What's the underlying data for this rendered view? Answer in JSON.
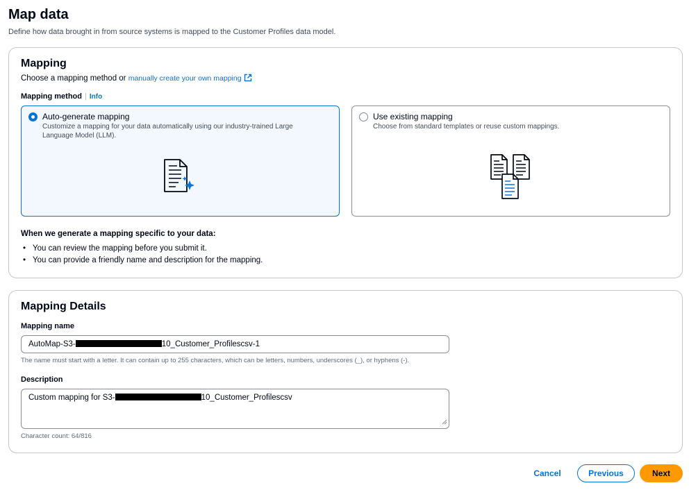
{
  "page": {
    "title": "Map data",
    "description": "Define how data brought in from source systems is mapped to the Customer Profiles data model."
  },
  "mapping": {
    "heading": "Mapping",
    "choose_text": "Choose a mapping method or",
    "manual_link": "manually create your own mapping",
    "method_label": "Mapping method",
    "info_link": "Info",
    "options": [
      {
        "title": "Auto-generate mapping",
        "description": "Customize a mapping for your data automatically using our industry-trained Large Language Model (LLM).",
        "selected": true,
        "icon": "document-sparkle-icon"
      },
      {
        "title": "Use existing mapping",
        "description": "Choose from standard templates or reuse custom mappings.",
        "selected": false,
        "icon": "documents-stack-icon"
      }
    ],
    "when_title": "When we generate a mapping specific to your data:",
    "bullets": [
      "You can review the mapping before you submit it.",
      "You can provide a friendly name and description for the mapping."
    ]
  },
  "details": {
    "heading": "Mapping Details",
    "name_label": "Mapping name",
    "name_prefix": "AutoMap-S3-",
    "name_suffix": "10_Customer_Profilescsv-1",
    "name_hint": "The name must start with a letter. It can contain up to 255 characters, which can be letters, numbers, underscores (_), or hyphens (-).",
    "desc_label": "Description",
    "desc_prefix": "Custom mapping for S3-",
    "desc_suffix": "10_Customer_Profilescsv",
    "char_count": "Character count: 64/816"
  },
  "actions": {
    "cancel": "Cancel",
    "previous": "Previous",
    "next": "Next"
  },
  "colors": {
    "accent": "#0972d3",
    "primary_button": "#ff9900",
    "selected_tile_bg": "#f2f8fd"
  }
}
